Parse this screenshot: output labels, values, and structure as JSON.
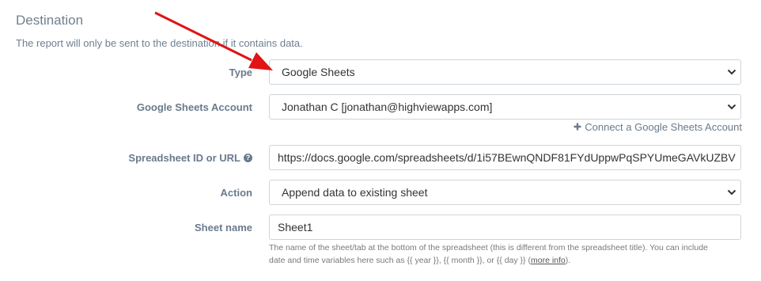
{
  "section": {
    "title": "Destination",
    "description": "The report will only be sent to the destination if it contains data."
  },
  "fields": {
    "type": {
      "label": "Type",
      "value": "Google Sheets"
    },
    "account": {
      "label": "Google Sheets Account",
      "value": "Jonathan C [jonathan@highviewapps.com]"
    },
    "connect_link": {
      "icon": "plus-icon",
      "label": "Connect a Google Sheets Account"
    },
    "spreadsheet": {
      "label": "Spreadsheet ID or URL",
      "help_icon": "question-circle-icon",
      "value": "https://docs.google.com/spreadsheets/d/1i57BEwnQNDF81FYdUppwPqSPYUmeGAVkUZBV"
    },
    "action": {
      "label": "Action",
      "value": "Append data to existing sheet"
    },
    "sheet_name": {
      "label": "Sheet name",
      "value": "Sheet1",
      "help_line1": "The name of the sheet/tab at the bottom of the spreadsheet (this is different from the spreadsheet title). You can include",
      "help_line2_prefix": "date and time variables here such as {{ year }}, {{ month }}, or {{ day }} (",
      "help_link": "more info",
      "help_line2_suffix": ")."
    }
  },
  "annotation": {
    "arrow_color": "#e01414"
  }
}
